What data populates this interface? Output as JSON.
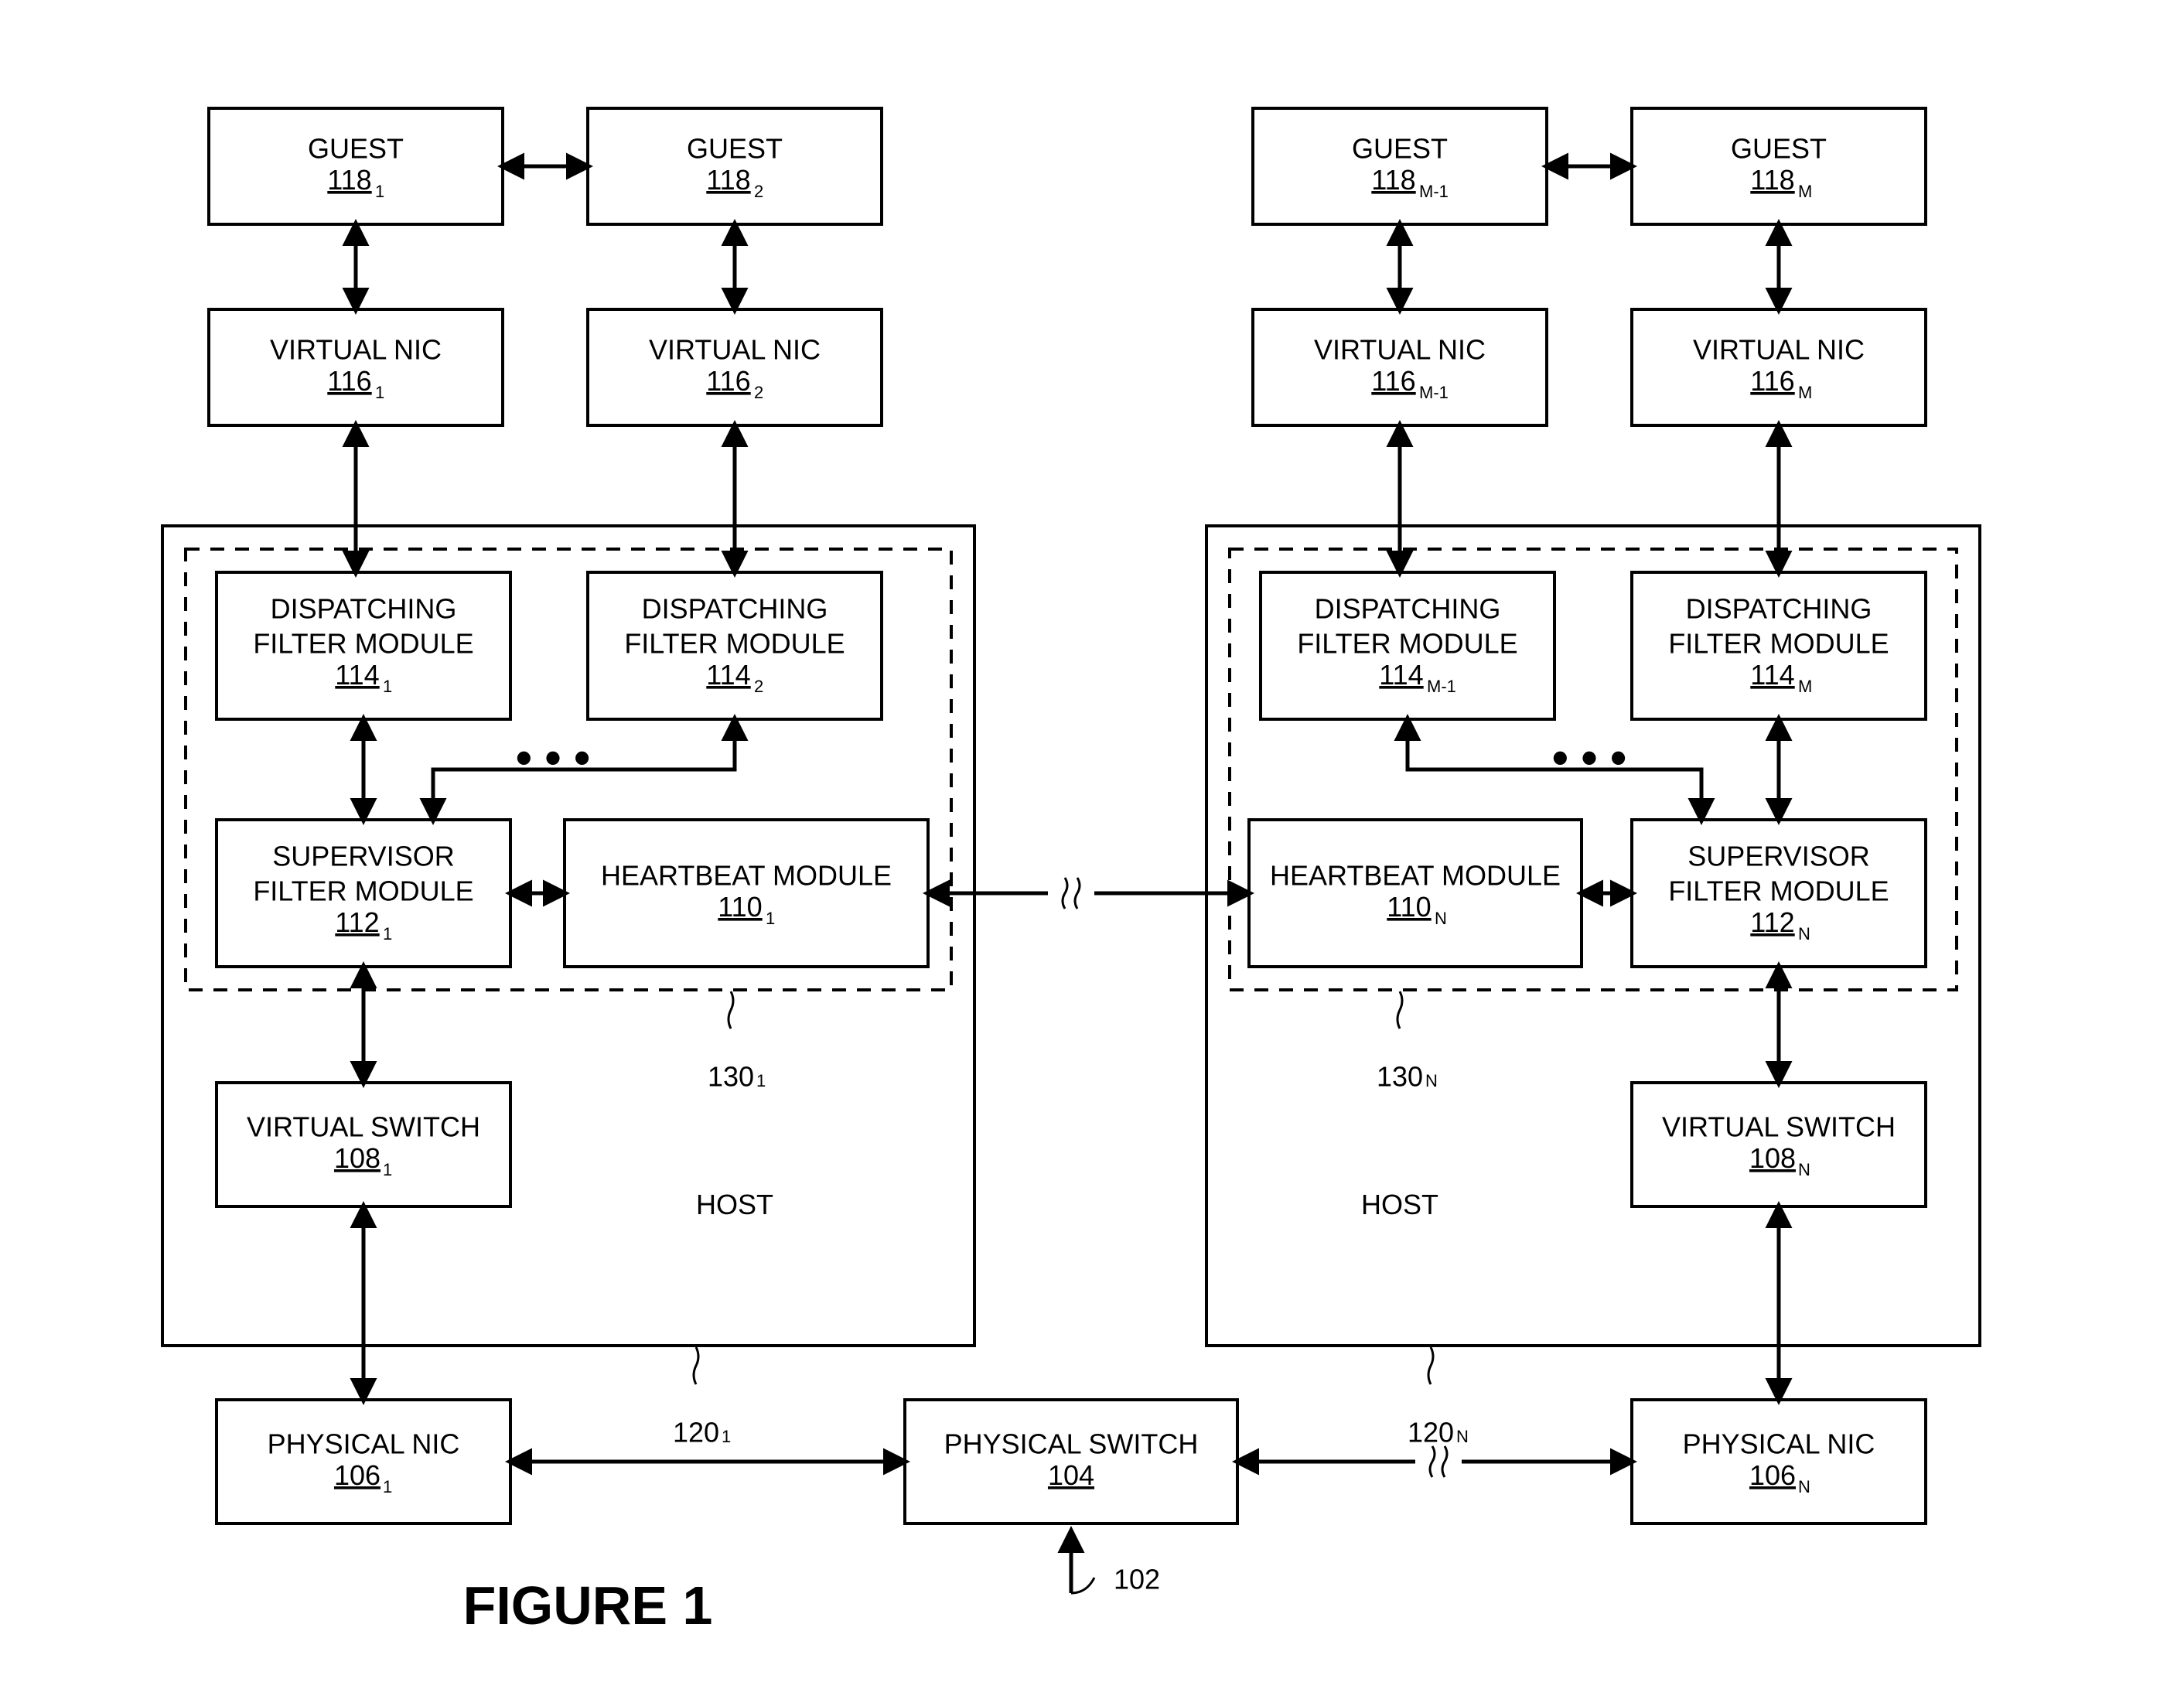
{
  "figure_title": "FIGURE 1",
  "system_ref": "102",
  "physical_switch": {
    "label": "PHYSICAL SWITCH",
    "ref": "104"
  },
  "left": {
    "guest_a": {
      "label": "GUEST",
      "ref": "118",
      "sub": "1"
    },
    "guest_b": {
      "label": "GUEST",
      "ref": "118",
      "sub": "2"
    },
    "vnic_a": {
      "label": "VIRTUAL NIC",
      "ref": "116",
      "sub": "1"
    },
    "vnic_b": {
      "label": "VIRTUAL NIC",
      "ref": "116",
      "sub": "2"
    },
    "dfm_a": {
      "label1": "DISPATCHING",
      "label2": "FILTER MODULE",
      "ref": "114",
      "sub": "1"
    },
    "dfm_b": {
      "label1": "DISPATCHING",
      "label2": "FILTER MODULE",
      "ref": "114",
      "sub": "2"
    },
    "sfm": {
      "label1": "SUPERVISOR",
      "label2": "FILTER MODULE",
      "ref": "112",
      "sub": "1"
    },
    "hbm": {
      "label": "HEARTBEAT MODULE",
      "ref": "110",
      "sub": "1"
    },
    "vswitch": {
      "label": "VIRTUAL SWITCH",
      "ref": "108",
      "sub": "1"
    },
    "pnic": {
      "label": "PHYSICAL NIC",
      "ref": "106",
      "sub": "1"
    },
    "host_label": "HOST",
    "host_ref": {
      "ref": "120",
      "sub": "1"
    },
    "dashed_ref": {
      "ref": "130",
      "sub": "1"
    }
  },
  "right": {
    "guest_a": {
      "label": "GUEST",
      "ref": "118",
      "sub": "M-1"
    },
    "guest_b": {
      "label": "GUEST",
      "ref": "118",
      "sub": "M"
    },
    "vnic_a": {
      "label": "VIRTUAL NIC",
      "ref": "116",
      "sub": "M-1"
    },
    "vnic_b": {
      "label": "VIRTUAL NIC",
      "ref": "116",
      "sub": "M"
    },
    "dfm_a": {
      "label1": "DISPATCHING",
      "label2": "FILTER MODULE",
      "ref": "114",
      "sub": "M-1"
    },
    "dfm_b": {
      "label1": "DISPATCHING",
      "label2": "FILTER MODULE",
      "ref": "114",
      "sub": "M"
    },
    "sfm": {
      "label1": "SUPERVISOR",
      "label2": "FILTER MODULE",
      "ref": "112",
      "sub": "N"
    },
    "hbm": {
      "label": "HEARTBEAT MODULE",
      "ref": "110",
      "sub": "N"
    },
    "vswitch": {
      "label": "VIRTUAL SWITCH",
      "ref": "108",
      "sub": "N"
    },
    "pnic": {
      "label": "PHYSICAL NIC",
      "ref": "106",
      "sub": "N"
    },
    "host_label": "HOST",
    "host_ref": {
      "ref": "120",
      "sub": "N"
    },
    "dashed_ref": {
      "ref": "130",
      "sub": "N"
    }
  },
  "ellipsis": "• • •"
}
